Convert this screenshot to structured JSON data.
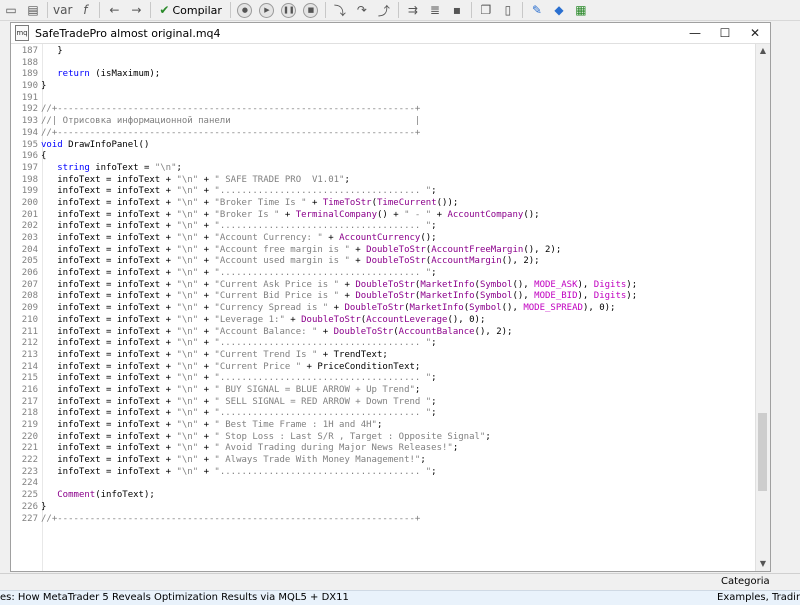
{
  "toolbar": {
    "compile_label": "Compilar",
    "var_label": "var",
    "f_label": "f"
  },
  "window": {
    "title": "SafeTradePro almost original.mq4",
    "minimize": "—",
    "maximize": "☐",
    "close": "✕"
  },
  "editor": {
    "lines": [
      {
        "n": "187",
        "t": "   }"
      },
      {
        "n": "188",
        "t": ""
      },
      {
        "n": "189",
        "t": "   return (isMaximum);"
      },
      {
        "n": "190",
        "t": "}"
      },
      {
        "n": "191",
        "t": ""
      },
      {
        "n": "192",
        "t": "//+------------------------------------------------------------------+"
      },
      {
        "n": "193",
        "t": "//| Отрисовка информационной панели                                  |"
      },
      {
        "n": "194",
        "t": "//+------------------------------------------------------------------+"
      },
      {
        "n": "195",
        "t": "void DrawInfoPanel()"
      },
      {
        "n": "196",
        "t": "{"
      },
      {
        "n": "197",
        "t": "   string infoText = \"\\n\";"
      },
      {
        "n": "198",
        "t": "   infoText = infoText + \"\\n\" + \" SAFE TRADE PRO  V1.01\";"
      },
      {
        "n": "199",
        "t": "   infoText = infoText + \"\\n\" + \"..................................... \";"
      },
      {
        "n": "200",
        "t": "   infoText = infoText + \"\\n\" + \"Broker Time Is \" + TimeToStr(TimeCurrent());"
      },
      {
        "n": "201",
        "t": "   infoText = infoText + \"\\n\" + \"Broker Is \" + TerminalCompany() + \" - \" + AccountCompany();"
      },
      {
        "n": "202",
        "t": "   infoText = infoText + \"\\n\" + \"..................................... \";"
      },
      {
        "n": "203",
        "t": "   infoText = infoText + \"\\n\" + \"Account Currency: \" + AccountCurrency();"
      },
      {
        "n": "204",
        "t": "   infoText = infoText + \"\\n\" + \"Account free margin is \" + DoubleToStr(AccountFreeMargin(), 2);"
      },
      {
        "n": "205",
        "t": "   infoText = infoText + \"\\n\" + \"Account used margin is \" + DoubleToStr(AccountMargin(), 2);"
      },
      {
        "n": "206",
        "t": "   infoText = infoText + \"\\n\" + \"..................................... \";"
      },
      {
        "n": "207",
        "t": "   infoText = infoText + \"\\n\" + \"Current Ask Price is \" + DoubleToStr(MarketInfo(Symbol(), MODE_ASK), Digits);"
      },
      {
        "n": "208",
        "t": "   infoText = infoText + \"\\n\" + \"Current Bid Price is \" + DoubleToStr(MarketInfo(Symbol(), MODE_BID), Digits);"
      },
      {
        "n": "209",
        "t": "   infoText = infoText + \"\\n\" + \"Currency Spread is \" + DoubleToStr(MarketInfo(Symbol(), MODE_SPREAD), 0);"
      },
      {
        "n": "210",
        "t": "   infoText = infoText + \"\\n\" + \"Leverage 1:\" + DoubleToStr(AccountLeverage(), 0);"
      },
      {
        "n": "211",
        "t": "   infoText = infoText + \"\\n\" + \"Account Balance: \" + DoubleToStr(AccountBalance(), 2);"
      },
      {
        "n": "212",
        "t": "   infoText = infoText + \"\\n\" + \"..................................... \";"
      },
      {
        "n": "213",
        "t": "   infoText = infoText + \"\\n\" + \"Current Trend Is \" + TrendText;"
      },
      {
        "n": "214",
        "t": "   infoText = infoText + \"\\n\" + \"Current Price \" + PriceConditionText;"
      },
      {
        "n": "215",
        "t": "   infoText = infoText + \"\\n\" + \"..................................... \";"
      },
      {
        "n": "216",
        "t": "   infoText = infoText + \"\\n\" + \" BUY SIGNAL = BLUE ARROW + Up Trend\";"
      },
      {
        "n": "217",
        "t": "   infoText = infoText + \"\\n\" + \" SELL SIGNAL = RED ARROW + Down Trend \";"
      },
      {
        "n": "218",
        "t": "   infoText = infoText + \"\\n\" + \"..................................... \";"
      },
      {
        "n": "219",
        "t": "   infoText = infoText + \"\\n\" + \" Best Time Frame : 1H and 4H\";"
      },
      {
        "n": "220",
        "t": "   infoText = infoText + \"\\n\" + \" Stop Loss : Last S/R , Target : Opposite Signal\";"
      },
      {
        "n": "221",
        "t": "   infoText = infoText + \"\\n\" + \" Avoid Trading during Major News Releases!\";"
      },
      {
        "n": "222",
        "t": "   infoText = infoText + \"\\n\" + \" Always Trade With Money Management!\";"
      },
      {
        "n": "223",
        "t": "   infoText = infoText + \"\\n\" + \"..................................... \";"
      },
      {
        "n": "224",
        "t": ""
      },
      {
        "n": "225",
        "t": "   Comment(infoText);"
      },
      {
        "n": "226",
        "t": "}"
      },
      {
        "n": "227",
        "t": "//+------------------------------------------------------------------+"
      }
    ]
  },
  "bottom": {
    "category_label": "Categoria",
    "status_left": "es: How MetaTrader 5 Reveals Optimization Results via MQL5 + DX11",
    "status_right": "Examples, Trading, Tra"
  },
  "colors": {
    "keyword": "#0000ff",
    "string": "#808080",
    "comment": "#808080",
    "function": "#8b008b",
    "constant": "#c000c0"
  },
  "icons": [
    "new-file-icon",
    "open-folder-icon",
    "var-icon",
    "function-icon",
    "back-arrow-icon",
    "forward-arrow-icon",
    "compile-check-icon",
    "debug-icon",
    "play-icon",
    "pause-icon",
    "stop-icon",
    "step-into-icon",
    "step-over-icon",
    "step-out-icon",
    "history-icon",
    "bookmark-icon",
    "copy-icon",
    "pen-icon",
    "navigator-icon",
    "toolbox-icon"
  ]
}
